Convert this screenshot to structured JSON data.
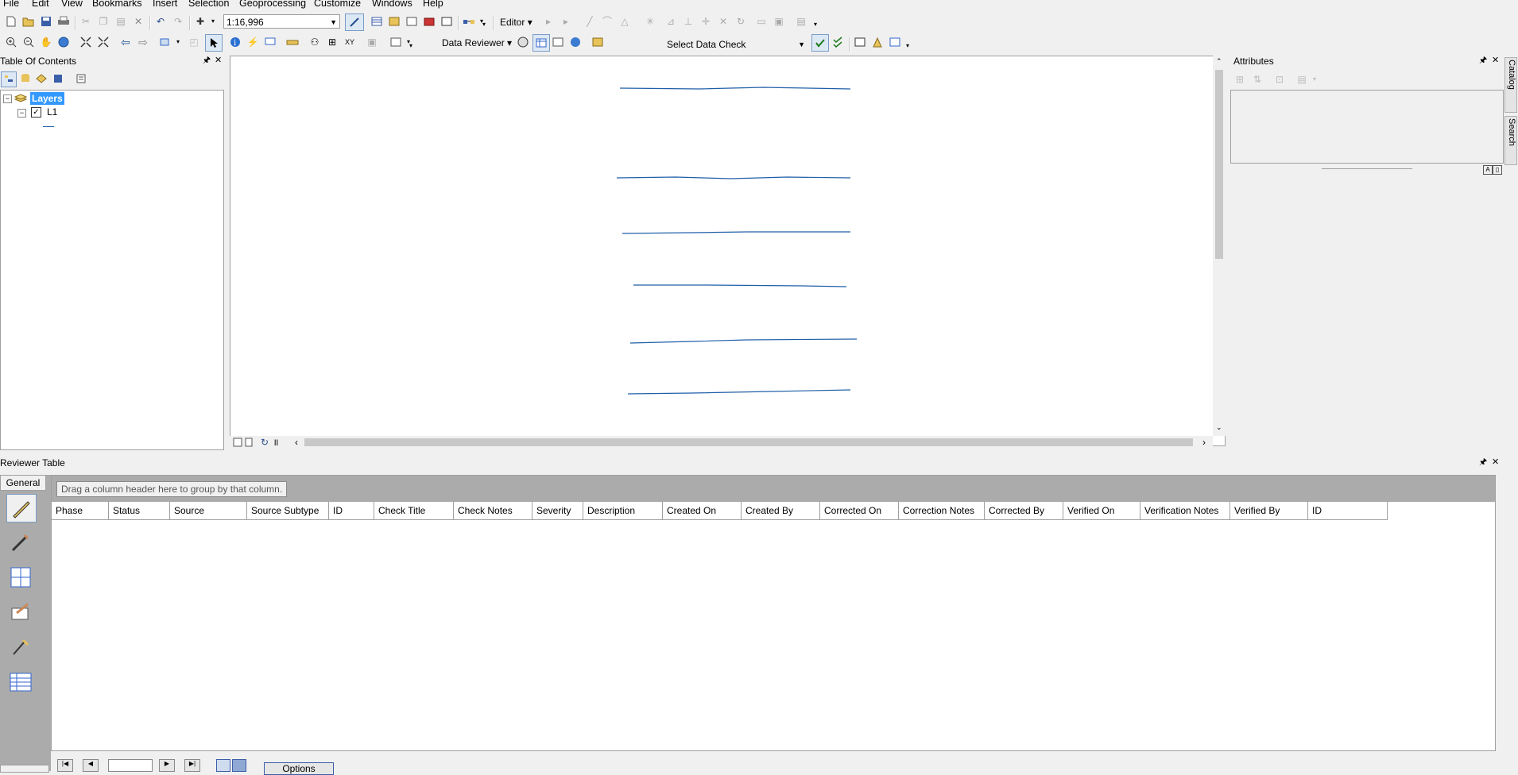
{
  "menu": [
    "File",
    "Edit",
    "View",
    "Bookmarks",
    "Insert",
    "Selection",
    "Geoprocessing",
    "Customize",
    "Windows",
    "Help"
  ],
  "toolbar": {
    "scale": "1:16,996",
    "editor_label": "Editor",
    "data_reviewer_label": "Data Reviewer",
    "select_data_check": "Select Data Check"
  },
  "toc": {
    "title": "Table Of Contents",
    "layers_label": "Layers",
    "layer_name": "L1",
    "layer_checked": true
  },
  "attributes": {
    "title": "Attributes"
  },
  "side_tabs": [
    "Catalog",
    "Search"
  ],
  "reviewer": {
    "title": "Reviewer Table",
    "tab_label": "General",
    "group_hint": "Drag a column header here to group by that column.",
    "columns": [
      "Phase",
      "Status",
      "Source",
      "Source Subtype",
      "ID",
      "Check Title",
      "Check Notes",
      "Severity",
      "Description",
      "Created On",
      "Created By",
      "Corrected On",
      "Correction Notes",
      "Corrected By",
      "Verified On",
      "Verification Notes",
      "Verified By",
      "ID"
    ],
    "options_button": "Options"
  },
  "colors": {
    "line_color": "#1f5fa8",
    "selection_highlight": "#3399ff",
    "panel_bg": "#f0f0f0"
  }
}
